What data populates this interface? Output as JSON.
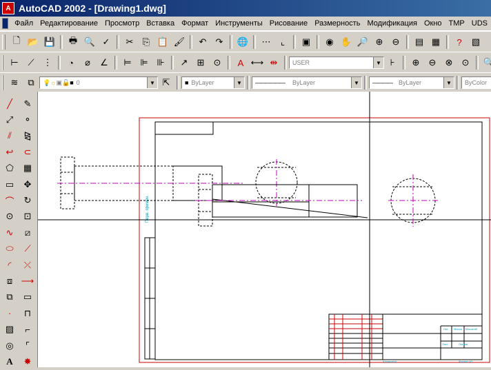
{
  "window": {
    "title": "AutoCAD 2002 - [Drawing1.dwg]",
    "app_icon_label": "A"
  },
  "menu": {
    "items": [
      "Файл",
      "Редактирование",
      "Просмотр",
      "Вставка",
      "Формат",
      "Инструменты",
      "Рисование",
      "Размерность",
      "Модификация",
      "Окно",
      "TMP",
      "UDS"
    ]
  },
  "toolbar_standard": {
    "icons": [
      "new-file-icon",
      "open-file-icon",
      "save-icon",
      "print-icon",
      "print-preview-icon",
      "spell-check-icon",
      "cut-icon",
      "copy-icon",
      "paste-icon",
      "match-properties-icon",
      "undo-icon",
      "redo-icon",
      "web-icon",
      "snap-tracking-icon",
      "ucs-icon",
      "named-views-icon",
      "3d-orbit-icon",
      "pan-icon",
      "zoom-realtime-icon",
      "zoom-window-icon",
      "properties-icon",
      "design-center-icon",
      "help-icon",
      "tool-palette-icon"
    ]
  },
  "toolbar_dimension": {
    "dimstyle": "USER"
  },
  "toolbar_layers": {
    "layer": "0",
    "color": "ByLayer",
    "linetype": "ByLayer",
    "lineweight": "ByLayer",
    "plotstyle": "ByColor"
  },
  "drawing": {
    "stamp_text_1": "Лит.",
    "stamp_text_2": "Масса",
    "stamp_text_3": "Масштаб",
    "stamp_text_4": "Лист",
    "stamp_text_5": "Листов",
    "stamp_text_6": "Копировал",
    "stamp_text_7": "Формат A3",
    "vertical_text": "Перв. примен."
  },
  "colors": {
    "frame_red": "#cc0000",
    "centerline_magenta": "#c000c0",
    "titlebar": "#0a246a",
    "annotation_cyan": "#00a0c0"
  }
}
